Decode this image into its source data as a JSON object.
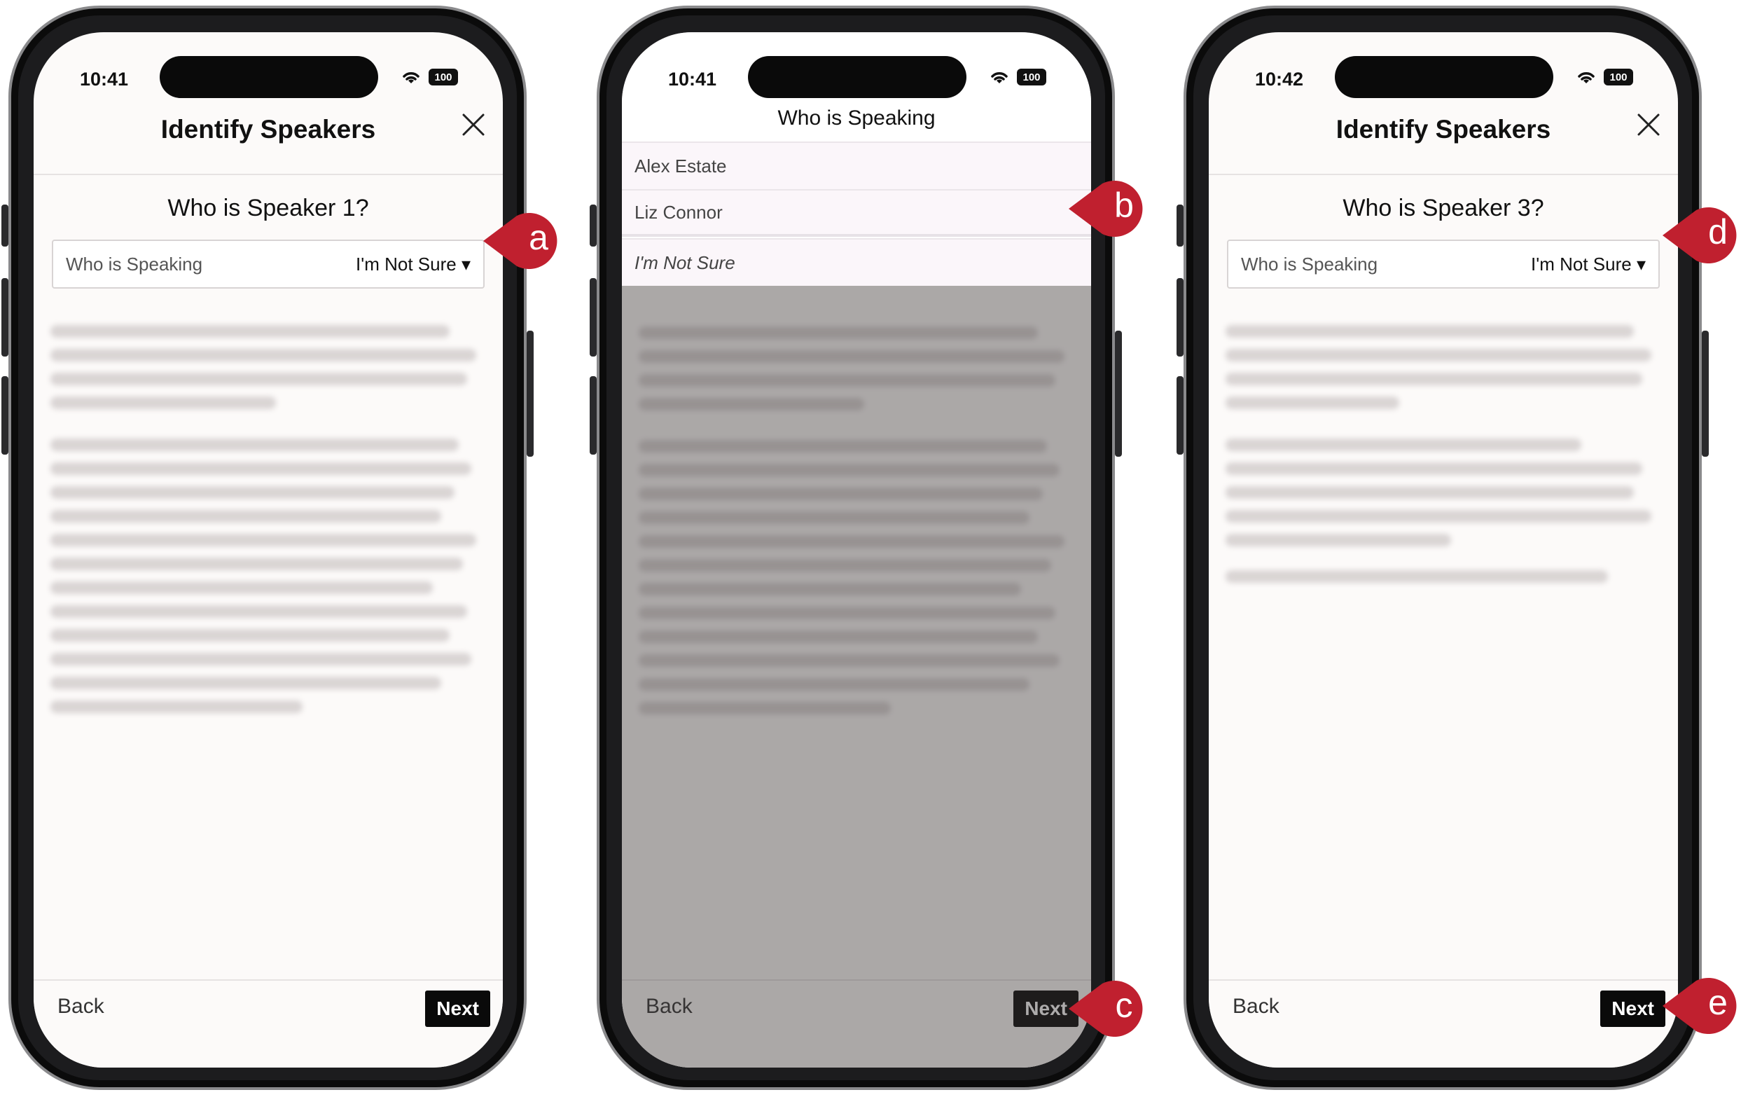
{
  "colors": {
    "callout": "#c0202f",
    "next_button": "#0a0a0a",
    "overlay": "rgba(60,55,55,0.42)"
  },
  "phones": [
    {
      "time": "10:41",
      "battery": "100",
      "header_title": "Identify Speakers",
      "question": "Who is Speaker 1?",
      "dropdown_label": "Who is Speaking",
      "dropdown_value": "I'm Not Sure ▾",
      "back": "Back",
      "next": "Next"
    },
    {
      "time": "10:41",
      "battery": "100",
      "picker_title": "Who is Speaking",
      "options": [
        "Alex Estate",
        "Liz Connor",
        "I'm Not Sure"
      ],
      "back": "Back",
      "next": "Next"
    },
    {
      "time": "10:42",
      "battery": "100",
      "header_title": "Identify Speakers",
      "question": "Who is Speaker 3?",
      "dropdown_label": "Who is Speaking",
      "dropdown_value": "I'm Not Sure ▾",
      "back": "Back",
      "next": "Next"
    }
  ],
  "callouts": [
    "a",
    "b",
    "c",
    "d",
    "e"
  ]
}
